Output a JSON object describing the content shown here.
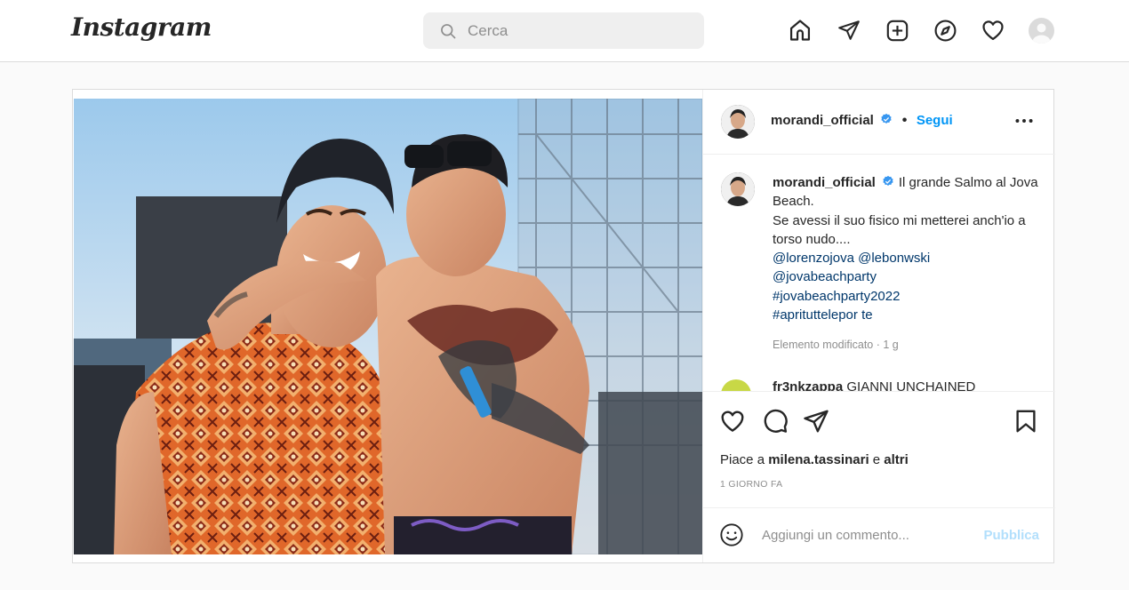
{
  "app": {
    "logo_text": "Instagram"
  },
  "search": {
    "placeholder": "Cerca",
    "icon": "search-icon"
  },
  "nav": {
    "icons": [
      "home-icon",
      "direct-icon",
      "new-post-icon",
      "explore-icon",
      "activity-icon",
      "avatar"
    ]
  },
  "post": {
    "author": "morandi_official",
    "follow_label": "Segui",
    "separator": "•",
    "caption_author": "morandi_official",
    "caption_line_1": "Il grande Salmo al Jova Beach.",
    "caption_line_2": "Se avessi il suo fisico mi metterei anch'io a torso nudo....",
    "mention_1": "@lorenzojova @lebonwski",
    "mention_2": "@jovabeachparty",
    "hashtag_1": "#jovabeachparty2022",
    "hashtag_2": "#aprituttelepor te",
    "caption_meta": "Elemento modificato · 1 g",
    "next_comment_author": "fr3nkzappa",
    "next_comment_text": "GIANNI UNCHAINED",
    "likes_prefix": "Piace a",
    "likes_user": "milena.tassinari",
    "likes_connector": "e",
    "likes_others": "altri",
    "time_ago": "1 GIORNO FA",
    "comment_placeholder": "Aggiungi un commento...",
    "publish_label": "Pubblica"
  },
  "colors": {
    "accent": "#0095f6",
    "publish_disabled": "#b2dffc",
    "verified": "#3897f0",
    "mention": "#00376b"
  }
}
